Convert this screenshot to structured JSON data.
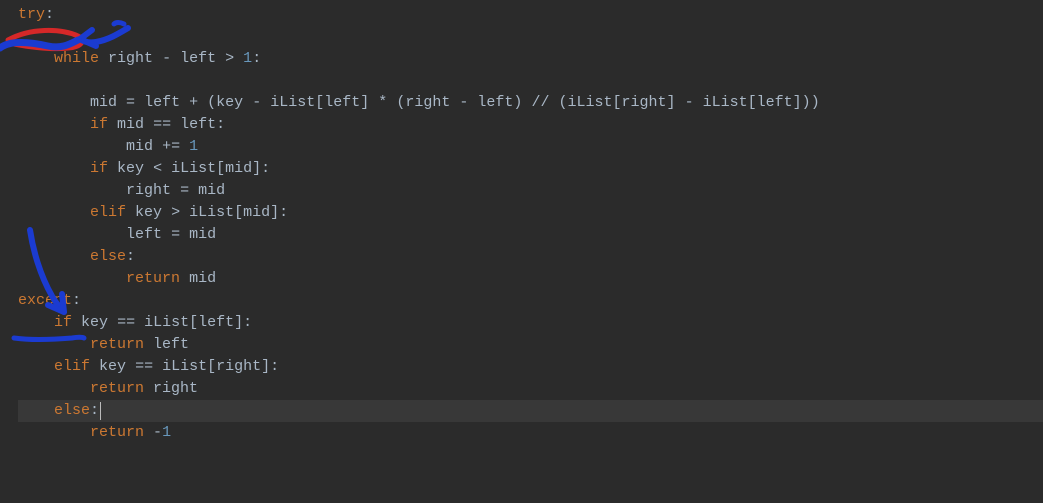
{
  "code": {
    "lines": [
      {
        "tokens": [
          [
            "kw",
            "try"
          ],
          [
            "op",
            ":"
          ]
        ]
      },
      {
        "tokens": []
      },
      {
        "tokens": [
          [
            "sp",
            "    "
          ],
          [
            "kw",
            "while"
          ],
          [
            "sp",
            " "
          ],
          [
            "id",
            "right"
          ],
          [
            "sp",
            " "
          ],
          [
            "op",
            "-"
          ],
          [
            "sp",
            " "
          ],
          [
            "id",
            "left"
          ],
          [
            "sp",
            " "
          ],
          [
            "op",
            ">"
          ],
          [
            "sp",
            " "
          ],
          [
            "num",
            "1"
          ],
          [
            "op",
            ":"
          ]
        ]
      },
      {
        "tokens": []
      },
      {
        "tokens": [
          [
            "sp",
            "        "
          ],
          [
            "id",
            "mid"
          ],
          [
            "sp",
            " "
          ],
          [
            "op",
            "="
          ],
          [
            "sp",
            " "
          ],
          [
            "id",
            "left"
          ],
          [
            "sp",
            " "
          ],
          [
            "op",
            "+"
          ],
          [
            "sp",
            " "
          ],
          [
            "br",
            "("
          ],
          [
            "id",
            "key"
          ],
          [
            "sp",
            " "
          ],
          [
            "op",
            "-"
          ],
          [
            "sp",
            " "
          ],
          [
            "id",
            "iList"
          ],
          [
            "br",
            "["
          ],
          [
            "id",
            "left"
          ],
          [
            "br",
            "]"
          ],
          [
            "sp",
            " "
          ],
          [
            "op",
            "*"
          ],
          [
            "sp",
            " "
          ],
          [
            "br",
            "("
          ],
          [
            "id",
            "right"
          ],
          [
            "sp",
            " "
          ],
          [
            "op",
            "-"
          ],
          [
            "sp",
            " "
          ],
          [
            "id",
            "left"
          ],
          [
            "br",
            ")"
          ],
          [
            "sp",
            " "
          ],
          [
            "op",
            "//"
          ],
          [
            "sp",
            " "
          ],
          [
            "br",
            "("
          ],
          [
            "id",
            "iList"
          ],
          [
            "br",
            "["
          ],
          [
            "id",
            "right"
          ],
          [
            "br",
            "]"
          ],
          [
            "sp",
            " "
          ],
          [
            "op",
            "-"
          ],
          [
            "sp",
            " "
          ],
          [
            "id",
            "iList"
          ],
          [
            "br",
            "["
          ],
          [
            "id",
            "left"
          ],
          [
            "br",
            "]"
          ],
          [
            "br",
            ")"
          ],
          [
            "br",
            ")"
          ]
        ]
      },
      {
        "tokens": [
          [
            "sp",
            "        "
          ],
          [
            "kw",
            "if"
          ],
          [
            "sp",
            " "
          ],
          [
            "id",
            "mid"
          ],
          [
            "sp",
            " "
          ],
          [
            "op",
            "=="
          ],
          [
            "sp",
            " "
          ],
          [
            "id",
            "left"
          ],
          [
            "op",
            ":"
          ]
        ]
      },
      {
        "tokens": [
          [
            "sp",
            "            "
          ],
          [
            "id",
            "mid"
          ],
          [
            "sp",
            " "
          ],
          [
            "op",
            "+="
          ],
          [
            "sp",
            " "
          ],
          [
            "num",
            "1"
          ]
        ]
      },
      {
        "tokens": [
          [
            "sp",
            "        "
          ],
          [
            "kw",
            "if"
          ],
          [
            "sp",
            " "
          ],
          [
            "id",
            "key"
          ],
          [
            "sp",
            " "
          ],
          [
            "op",
            "<"
          ],
          [
            "sp",
            " "
          ],
          [
            "id",
            "iList"
          ],
          [
            "br",
            "["
          ],
          [
            "id",
            "mid"
          ],
          [
            "br",
            "]"
          ],
          [
            "op",
            ":"
          ]
        ]
      },
      {
        "tokens": [
          [
            "sp",
            "            "
          ],
          [
            "id",
            "right"
          ],
          [
            "sp",
            " "
          ],
          [
            "op",
            "="
          ],
          [
            "sp",
            " "
          ],
          [
            "id",
            "mid"
          ]
        ]
      },
      {
        "tokens": [
          [
            "sp",
            "        "
          ],
          [
            "kw",
            "elif"
          ],
          [
            "sp",
            " "
          ],
          [
            "id",
            "key"
          ],
          [
            "sp",
            " "
          ],
          [
            "op",
            ">"
          ],
          [
            "sp",
            " "
          ],
          [
            "id",
            "iList"
          ],
          [
            "br",
            "["
          ],
          [
            "id",
            "mid"
          ],
          [
            "br",
            "]"
          ],
          [
            "op",
            ":"
          ]
        ]
      },
      {
        "tokens": [
          [
            "sp",
            "            "
          ],
          [
            "id",
            "left"
          ],
          [
            "sp",
            " "
          ],
          [
            "op",
            "="
          ],
          [
            "sp",
            " "
          ],
          [
            "id",
            "mid"
          ]
        ]
      },
      {
        "tokens": [
          [
            "sp",
            "        "
          ],
          [
            "kw",
            "else"
          ],
          [
            "op",
            ":"
          ]
        ]
      },
      {
        "tokens": [
          [
            "sp",
            "            "
          ],
          [
            "kw",
            "return"
          ],
          [
            "sp",
            " "
          ],
          [
            "id",
            "mid"
          ]
        ]
      },
      {
        "tokens": [
          [
            "kw",
            "except"
          ],
          [
            "op",
            ":"
          ]
        ]
      },
      {
        "tokens": [
          [
            "sp",
            "    "
          ],
          [
            "kw",
            "if"
          ],
          [
            "sp",
            " "
          ],
          [
            "id",
            "key"
          ],
          [
            "sp",
            " "
          ],
          [
            "op",
            "=="
          ],
          [
            "sp",
            " "
          ],
          [
            "id",
            "iList"
          ],
          [
            "br",
            "["
          ],
          [
            "id",
            "left"
          ],
          [
            "br",
            "]"
          ],
          [
            "op",
            ":"
          ]
        ]
      },
      {
        "tokens": [
          [
            "sp",
            "        "
          ],
          [
            "kw",
            "return"
          ],
          [
            "sp",
            " "
          ],
          [
            "id",
            "left"
          ]
        ]
      },
      {
        "tokens": [
          [
            "sp",
            "    "
          ],
          [
            "kw",
            "elif"
          ],
          [
            "sp",
            " "
          ],
          [
            "id",
            "key"
          ],
          [
            "sp",
            " "
          ],
          [
            "op",
            "=="
          ],
          [
            "sp",
            " "
          ],
          [
            "id",
            "iList"
          ],
          [
            "br",
            "["
          ],
          [
            "id",
            "right"
          ],
          [
            "br",
            "]"
          ],
          [
            "op",
            ":"
          ]
        ]
      },
      {
        "tokens": [
          [
            "sp",
            "        "
          ],
          [
            "kw",
            "return"
          ],
          [
            "sp",
            " "
          ],
          [
            "id",
            "right"
          ]
        ]
      },
      {
        "tokens": [
          [
            "sp",
            "    "
          ],
          [
            "kw",
            "else"
          ],
          [
            "op",
            ":"
          ]
        ],
        "highlighted": true,
        "cursor": true
      },
      {
        "tokens": [
          [
            "sp",
            "        "
          ],
          [
            "kw",
            "return"
          ],
          [
            "sp",
            " "
          ],
          [
            "op",
            "-"
          ],
          [
            "num",
            "1"
          ]
        ]
      }
    ]
  },
  "annotations": {
    "red_stroke_color": "#d62828",
    "blue_stroke_color": "#1b3bd1"
  }
}
